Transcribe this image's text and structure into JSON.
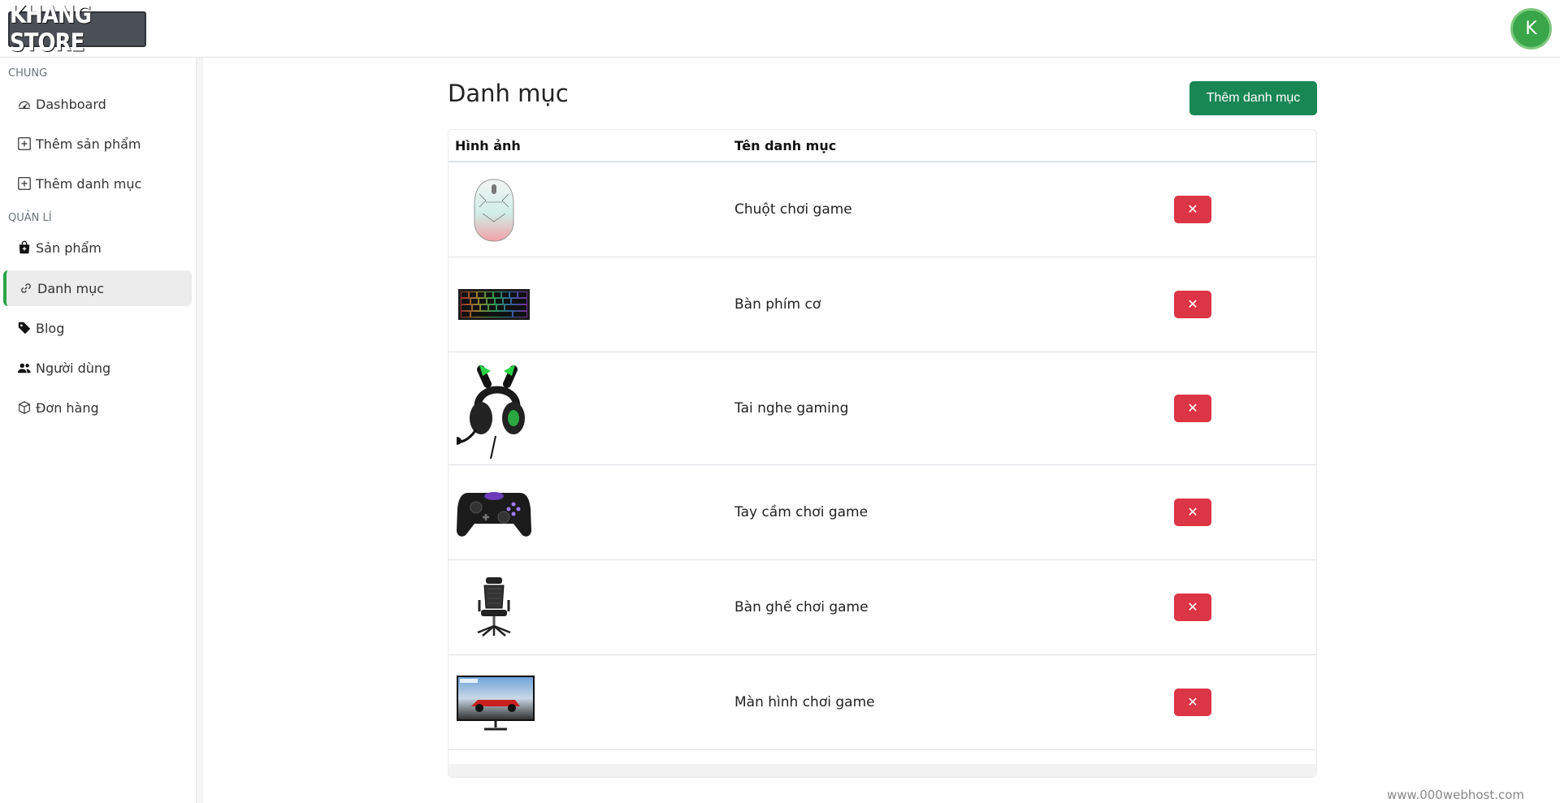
{
  "header": {
    "logo_text": "KHANG STORE",
    "avatar_letter": "K"
  },
  "sidebar": {
    "section_general": "CHUNG",
    "section_manage": "QUẢN LÍ",
    "items": [
      {
        "label": "Dashboard",
        "icon": "speedometer-icon"
      },
      {
        "label": "Thêm sản phẩm",
        "icon": "plus-square-icon"
      },
      {
        "label": "Thêm danh mục",
        "icon": "plus-square-icon"
      },
      {
        "label": "Sản phẩm",
        "icon": "shopping-bag-icon"
      },
      {
        "label": "Danh mục",
        "icon": "link-icon",
        "active": true
      },
      {
        "label": "Blog",
        "icon": "tag-icon"
      },
      {
        "label": "Người dùng",
        "icon": "users-icon"
      },
      {
        "label": "Đơn hàng",
        "icon": "box-icon"
      }
    ]
  },
  "main": {
    "title": "Danh mục",
    "add_button": "Thêm danh mục",
    "columns": [
      "Hình ảnh",
      "Tên danh mục"
    ],
    "delete_label": "✕",
    "rows": [
      {
        "name": "Chuột chơi game",
        "image": "gaming-mouse-image"
      },
      {
        "name": "Bàn phím cơ",
        "image": "mechanical-keyboard-image"
      },
      {
        "name": "Tai nghe gaming",
        "image": "gaming-headset-image"
      },
      {
        "name": "Tay cầm chơi game",
        "image": "game-controller-image"
      },
      {
        "name": "Bàn ghế chơi game",
        "image": "gaming-chair-image"
      },
      {
        "name": "Màn hình chơi game",
        "image": "gaming-monitor-image"
      }
    ]
  },
  "watermark": "www.000webhost.com",
  "colors": {
    "primary_green": "#198754",
    "danger_red": "#dc3545",
    "active_indicator": "#28a745",
    "avatar_bg": "#3aa64a"
  }
}
